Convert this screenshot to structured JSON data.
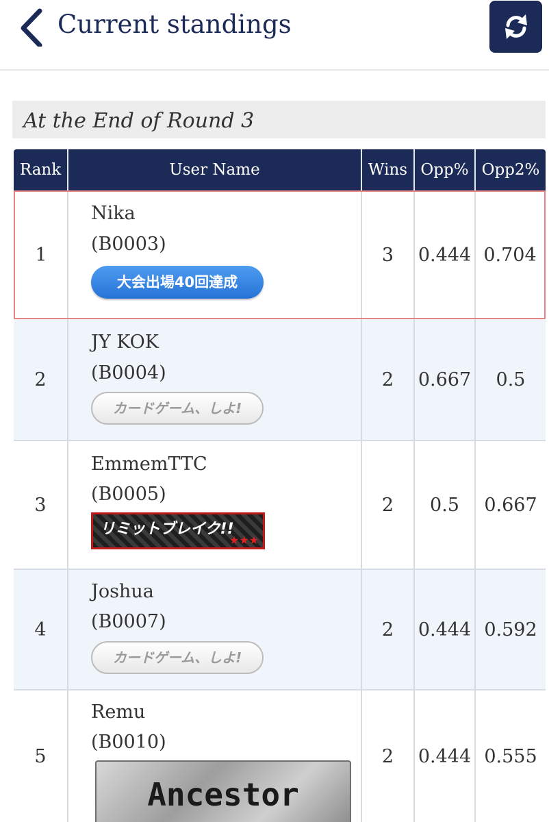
{
  "header": {
    "title": "Current standings"
  },
  "round_title": "At the End of Round 3",
  "table": {
    "columns": [
      "Rank",
      "User Name",
      "Wins",
      "Opp%",
      "Opp2%"
    ],
    "rows": [
      {
        "rank": "1",
        "name": "Nika",
        "id": "(B0003)",
        "badge": "大会出場40回達成",
        "wins": "3",
        "opp": "0.444",
        "opp2": "0.704"
      },
      {
        "rank": "2",
        "name": "JY KOK",
        "id": "(B0004)",
        "badge": "カードゲーム、しよ!",
        "wins": "2",
        "opp": "0.667",
        "opp2": "0.5"
      },
      {
        "rank": "3",
        "name": "EmmemTTC",
        "id": "(B0005)",
        "badge": "リミットブレイク!!",
        "wins": "2",
        "opp": "0.5",
        "opp2": "0.667"
      },
      {
        "rank": "4",
        "name": "Joshua",
        "id": "(B0007)",
        "badge": "カードゲーム、しよ!",
        "wins": "2",
        "opp": "0.444",
        "opp2": "0.592"
      },
      {
        "rank": "5",
        "name": "Remu",
        "id": "(B0010)",
        "badge": "Ancestor",
        "wins": "2",
        "opp": "0.444",
        "opp2": "0.555"
      }
    ]
  },
  "icons": {
    "back": "chevron-left-icon",
    "refresh": "refresh-icon"
  },
  "colors": {
    "navy": "#1c2a57",
    "highlight_border": "#e48686",
    "alt_row": "#f0f5fb"
  }
}
